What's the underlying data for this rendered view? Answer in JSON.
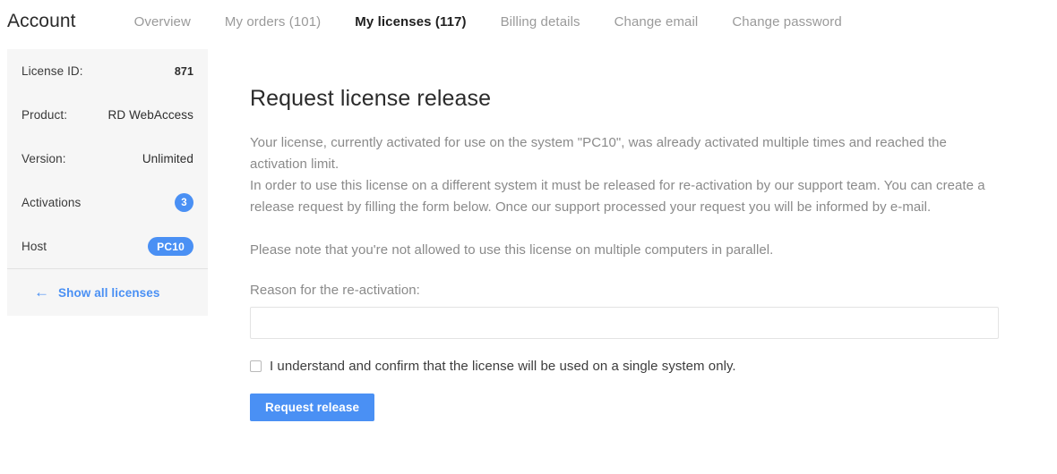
{
  "header": {
    "brand": "Account",
    "tabs": [
      {
        "label": "Overview",
        "active": false
      },
      {
        "label": "My orders (101)",
        "active": false
      },
      {
        "label": "My licenses (117)",
        "active": true
      },
      {
        "label": "Billing details",
        "active": false
      },
      {
        "label": "Change email",
        "active": false
      },
      {
        "label": "Change password",
        "active": false
      }
    ]
  },
  "sidebar": {
    "rows": [
      {
        "label": "License ID:",
        "value": "871",
        "type": "bold-text"
      },
      {
        "label": "Product:",
        "value": "RD WebAccess",
        "type": "text"
      },
      {
        "label": "Version:",
        "value": "Unlimited",
        "type": "text"
      },
      {
        "label": "Activations",
        "value": "3",
        "type": "badge-round"
      },
      {
        "label": "Host",
        "value": "PC10",
        "type": "badge-pill"
      }
    ],
    "back_link": {
      "icon": "arrow-left-icon",
      "glyph": "←",
      "label": "Show all licenses"
    }
  },
  "main": {
    "title": "Request license release",
    "paragraph_1": "Your license, currently activated for use on the system \"PC10\", was already activated multiple times and reached the activation limit.",
    "paragraph_2": "In order to use this license on a different system it must be released for re-activation by our support team. You can create a release request by filling the form below. Once our support processed your request you will be informed by e-mail.",
    "paragraph_3": "Please note that you're not allowed to use this license on multiple computers in parallel.",
    "reason_label": "Reason for the re-activation:",
    "reason_value": "",
    "reason_placeholder": "",
    "confirm_label": "I understand and confirm that the license will be used on a single system only.",
    "confirm_checked": false,
    "submit_label": "Request release"
  },
  "colors": {
    "accent_blue": "#4a90f4",
    "sidebar_bg": "#f6f6f6",
    "body_text": "#8a8a8a",
    "heading_text": "#2b2b2b",
    "border": "#e3e3e3"
  }
}
